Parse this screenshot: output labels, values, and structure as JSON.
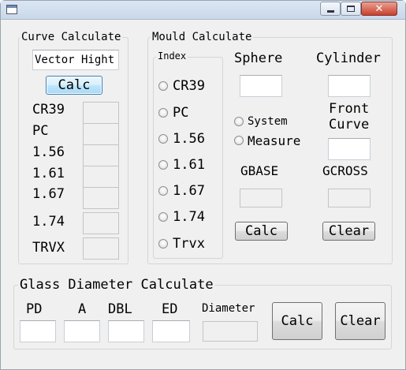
{
  "window": {
    "title": ""
  },
  "curve": {
    "legend": "Curve Calculate",
    "input_value": "Vector Hight",
    "calc_label": "Calc",
    "rows": [
      "CR39",
      "PC",
      "1.56",
      "1.61",
      "1.67",
      "1.74",
      "TRVX"
    ]
  },
  "mould": {
    "legend": "Mould Calculate",
    "index_legend": "Index",
    "index_options": [
      "CR39",
      "PC",
      "1.56",
      "1.61",
      "1.67",
      "1.74",
      "Trvx"
    ],
    "sphere_label": "Sphere",
    "cylinder_label": "Cylinder",
    "system_label": "System",
    "measure_label": "Measure",
    "front_curve_label": "Front\nCurve",
    "gbase_label": "GBASE",
    "gcross_label": "GCROSS",
    "calc_label": "Calc",
    "clear_label": "Clear"
  },
  "glass": {
    "legend": "Glass Diameter Calculate",
    "pd_label": "PD",
    "a_label": "A",
    "dbl_label": "DBL",
    "ed_label": "ED",
    "diameter_label": "Diameter",
    "calc_label": "Calc",
    "clear_label": "Clear"
  }
}
